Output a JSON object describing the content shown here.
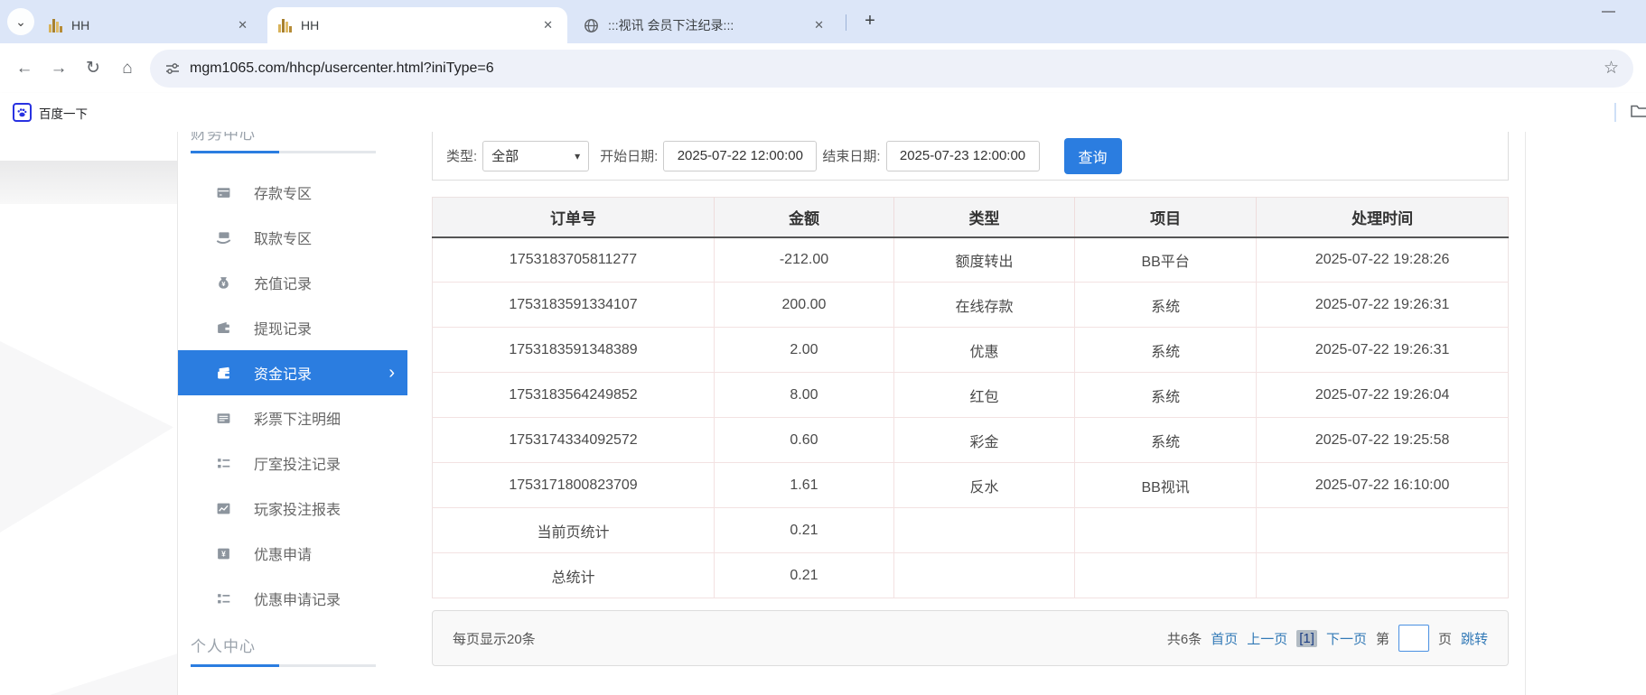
{
  "browser": {
    "minimize": "—",
    "tabs": [
      {
        "title": "HH"
      },
      {
        "title": "HH"
      },
      {
        "title": ":::视讯 会员下注纪录:::"
      }
    ],
    "url": "mgm1065.com/hhcp/usercenter.html?iniType=6",
    "bookmarks": {
      "baidu": "百度一下"
    }
  },
  "icons": {
    "tab_chevron": "⌄",
    "close": "✕",
    "new_tab": "+",
    "back": "←",
    "forward": "→",
    "reload": "↻",
    "home": "⌂",
    "star": "☆",
    "active_chevron": "›",
    "select_caret": "▾"
  },
  "sidebar": {
    "section_finance": "财务中心",
    "section_personal": "个人中心",
    "items": [
      {
        "label": "存款专区"
      },
      {
        "label": "取款专区"
      },
      {
        "label": "充值记录"
      },
      {
        "label": "提现记录"
      },
      {
        "label": "资金记录",
        "active": true
      },
      {
        "label": "彩票下注明细"
      },
      {
        "label": "厅室投注记录"
      },
      {
        "label": "玩家投注报表"
      },
      {
        "label": "优惠申请"
      },
      {
        "label": "优惠申请记录"
      }
    ]
  },
  "filters": {
    "type_label": "类型:",
    "type_value": "全部",
    "start_label": "开始日期:",
    "start_value": "2025-07-22 12:00:00",
    "end_label": "结束日期:",
    "end_value": "2025-07-23 12:00:00",
    "search": "查询"
  },
  "table": {
    "headers": [
      "订单号",
      "金额",
      "类型",
      "项目",
      "处理时间"
    ],
    "rows": [
      [
        "1753183705811277",
        "-212.00",
        "额度转出",
        "BB平台",
        "2025-07-22 19:28:26"
      ],
      [
        "1753183591334107",
        "200.00",
        "在线存款",
        "系统",
        "2025-07-22 19:26:31"
      ],
      [
        "1753183591348389",
        "2.00",
        "优惠",
        "系统",
        "2025-07-22 19:26:31"
      ],
      [
        "1753183564249852",
        "8.00",
        "红包",
        "系统",
        "2025-07-22 19:26:04"
      ],
      [
        "1753174334092572",
        "0.60",
        "彩金",
        "系统",
        "2025-07-22 19:25:58"
      ],
      [
        "1753171800823709",
        "1.61",
        "反水",
        "BB视讯",
        "2025-07-22 16:10:00"
      ],
      [
        "当前页统计",
        "0.21",
        "",
        "",
        ""
      ],
      [
        "总统计",
        "0.21",
        "",
        "",
        ""
      ]
    ]
  },
  "pagination": {
    "per_page": "每页显示20条",
    "total": "共6条",
    "first": "首页",
    "prev": "上一页",
    "current": "[1]",
    "next": "下一页",
    "jump_prefix": "第",
    "jump_suffix": "页",
    "jump_action": "跳转",
    "jump_value": ""
  },
  "colors": {
    "accent_blue": "#2b7de0",
    "link_blue": "#337ab7",
    "baidu_blue": "#2932e1"
  }
}
